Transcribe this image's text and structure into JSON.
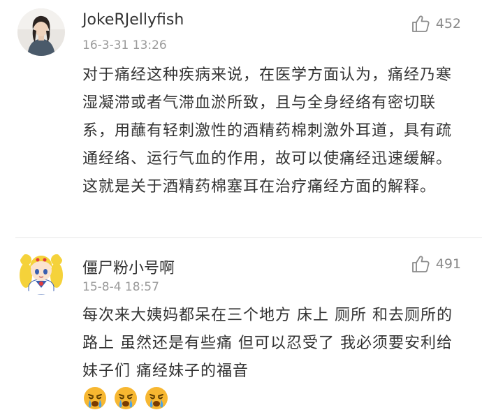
{
  "comments": [
    {
      "username": "JokeRJellyfish",
      "timestamp": "16-3-31 13:26",
      "likes": "452",
      "text": "对于痛经这种疾病来说，在医学方面认为，痛经乃寒湿凝滞或者气滞血淤所致，且与全身经络有密切联系，用蘸有轻刺激性的酒精药棉刺激外耳道，具有疏通经络、运行气血的作用，故可以使痛经迅速缓解。这就是关于酒精药棉塞耳在治疗痛经方面的解释。",
      "avatar_icon": "user-photo-avatar"
    },
    {
      "username": "僵尸粉小号啊",
      "timestamp": "15-8-4 18:57",
      "likes": "491",
      "text": "每次来大姨妈都呆在三个地方  床上  厕所  和去厕所的路上  虽然还是有些痛  但可以忍受了  我必须要安利给妹子们  痛经妹子的福音",
      "emojis": [
        "crying-face-emoji",
        "crying-face-emoji",
        "crying-face-emoji"
      ],
      "avatar_icon": "anime-character-avatar"
    }
  ],
  "icons": {
    "like": "thumbs-up-icon"
  },
  "colors": {
    "text": "#333333",
    "meta": "#9a9a9a",
    "like": "#8a8a8a",
    "emoji_face": "#f7b731",
    "tears": "#4aa3e8"
  }
}
